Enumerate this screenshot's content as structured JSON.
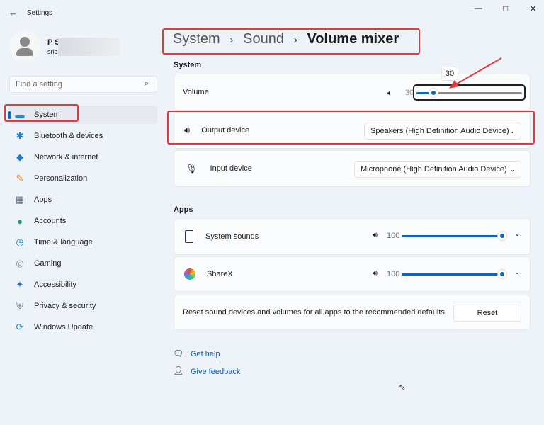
{
  "window": {
    "title": "Settings",
    "back": "back-arrow",
    "minimize": "—",
    "maximize": "□",
    "close": "✕"
  },
  "user": {
    "name": "P S",
    "email": "sric"
  },
  "search": {
    "placeholder": "Find a setting"
  },
  "sidebar": {
    "items": [
      {
        "label": "System",
        "icon": "▬",
        "color": "#1a8ad4"
      },
      {
        "label": "Bluetooth & devices",
        "icon": "✱",
        "color": "#1a7fd4"
      },
      {
        "label": "Network & internet",
        "icon": "◆",
        "color": "#1a7fd4"
      },
      {
        "label": "Personalization",
        "icon": "✎",
        "color": "#d08030"
      },
      {
        "label": "Apps",
        "icon": "▦",
        "color": "#5a6b80"
      },
      {
        "label": "Accounts",
        "icon": "●",
        "color": "#1fa36a"
      },
      {
        "label": "Time & language",
        "icon": "◷",
        "color": "#1a8ad4"
      },
      {
        "label": "Gaming",
        "icon": "◎",
        "color": "#7a8594"
      },
      {
        "label": "Accessibility",
        "icon": "✦",
        "color": "#1a6fd4"
      },
      {
        "label": "Privacy & security",
        "icon": "⛨",
        "color": "#6a7686"
      },
      {
        "label": "Windows Update",
        "icon": "⟳",
        "color": "#1a7fd4"
      }
    ]
  },
  "breadcrumb": {
    "part1": "System",
    "sep": "›",
    "part2": "Sound",
    "current": "Volume mixer"
  },
  "system": {
    "heading": "System",
    "volume_label": "Volume",
    "volume_value": "30",
    "volume_tooltip": "30",
    "volume_percent": 30,
    "output_label": "Output device",
    "output_value": "Speakers (High Definition Audio Device)",
    "input_label": "Input device",
    "input_value": "Microphone (High Definition Audio Device)"
  },
  "apps": {
    "heading": "Apps",
    "items": [
      {
        "label": "System sounds",
        "value": "100",
        "percent": 100
      },
      {
        "label": "ShareX",
        "value": "100",
        "percent": 100
      }
    ],
    "reset_text": "Reset sound devices and volumes for all apps to the recommended defaults",
    "reset_button": "Reset"
  },
  "links": {
    "help": "Get help",
    "feedback": "Give feedback"
  },
  "colors": {
    "accent": "#0a64c0",
    "annotation": "#e03a3a"
  }
}
